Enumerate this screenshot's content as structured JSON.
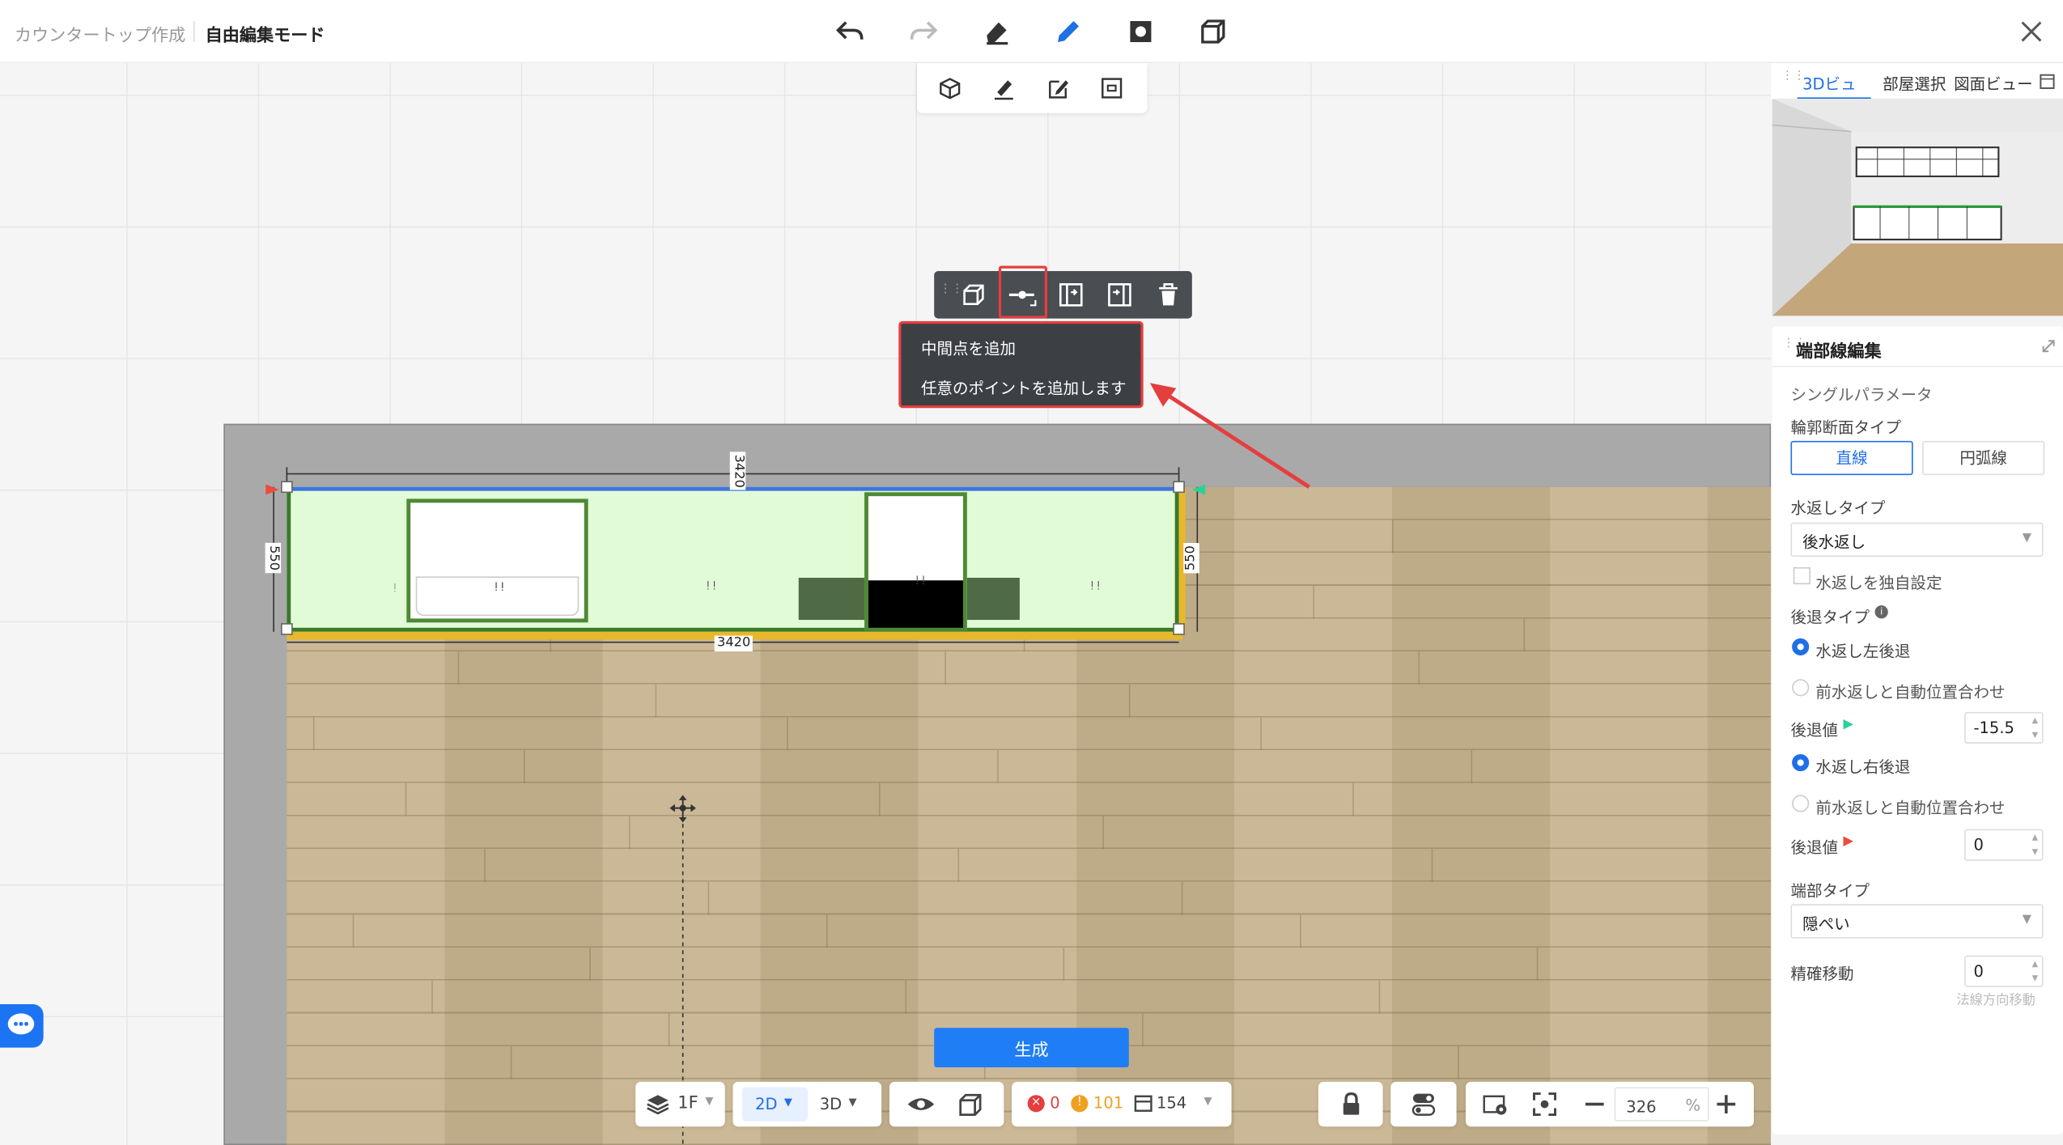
{
  "header": {
    "breadcrumb_parent": "カウンタートップ作成",
    "breadcrumb_current": "自由編集モード"
  },
  "toolbar": {
    "tools": [
      "undo-icon",
      "redo-icon",
      "eraser-icon",
      "pencil-icon",
      "square-icon",
      "box-icon"
    ],
    "active_tool": "pencil-icon"
  },
  "sub_toolbar": {
    "tools": [
      "cube-icon",
      "brush-icon",
      "edit-icon",
      "frame-icon"
    ]
  },
  "floating_toolbar": {
    "tools": [
      "extrude-icon",
      "add-point-icon",
      "insert-left-icon",
      "insert-right-icon",
      "trash-icon"
    ],
    "highlighted": "add-point-icon"
  },
  "context_menu": {
    "items": [
      "中間点を追加",
      "任意のポイントを追加します"
    ]
  },
  "canvas": {
    "dim_top": "3420",
    "dim_bottom": "3420",
    "dim_left": "550",
    "dim_right": "550"
  },
  "view_tabs": {
    "tabs": [
      "3Dビュー",
      "部屋選択",
      "図面ビュー"
    ],
    "active": "3Dビュー"
  },
  "panel": {
    "title": "端部線編集",
    "section": "シングルパラメータ",
    "profile_label": "輪郭断面タイプ",
    "profile_options": [
      "直線",
      "円弧線"
    ],
    "profile_active": "直線",
    "backsplash_label": "水返しタイプ",
    "backsplash_value": "後水返し",
    "independent_label": "水返しを独自設定",
    "recess_label": "後退タイプ",
    "left_recess_label": "水返し左後退",
    "left_auto_label": "前水返しと自動位置合わせ",
    "recess_value_label": "後退値",
    "recess_left_value": "-15.5",
    "right_recess_label": "水返し右後退",
    "right_auto_label": "前水返しと自動位置合わせ",
    "recess_right_value": "0",
    "end_type_label": "端部タイプ",
    "end_type_value": "隠ぺい",
    "precise_label": "精確移動",
    "precise_value": "0",
    "precise_hint": "法線方向移動",
    "colors": {
      "accent": "#1f6fe6",
      "left_marker": "#2bd19a",
      "right_marker": "#f04a3a"
    }
  },
  "bottom": {
    "floor": "1F",
    "view_2d": "2D",
    "view_3d": "3D",
    "errors": "0",
    "warnings": "101",
    "items": "154",
    "zoom": "326",
    "zoom_unit": "%",
    "generate_label": "生成"
  }
}
